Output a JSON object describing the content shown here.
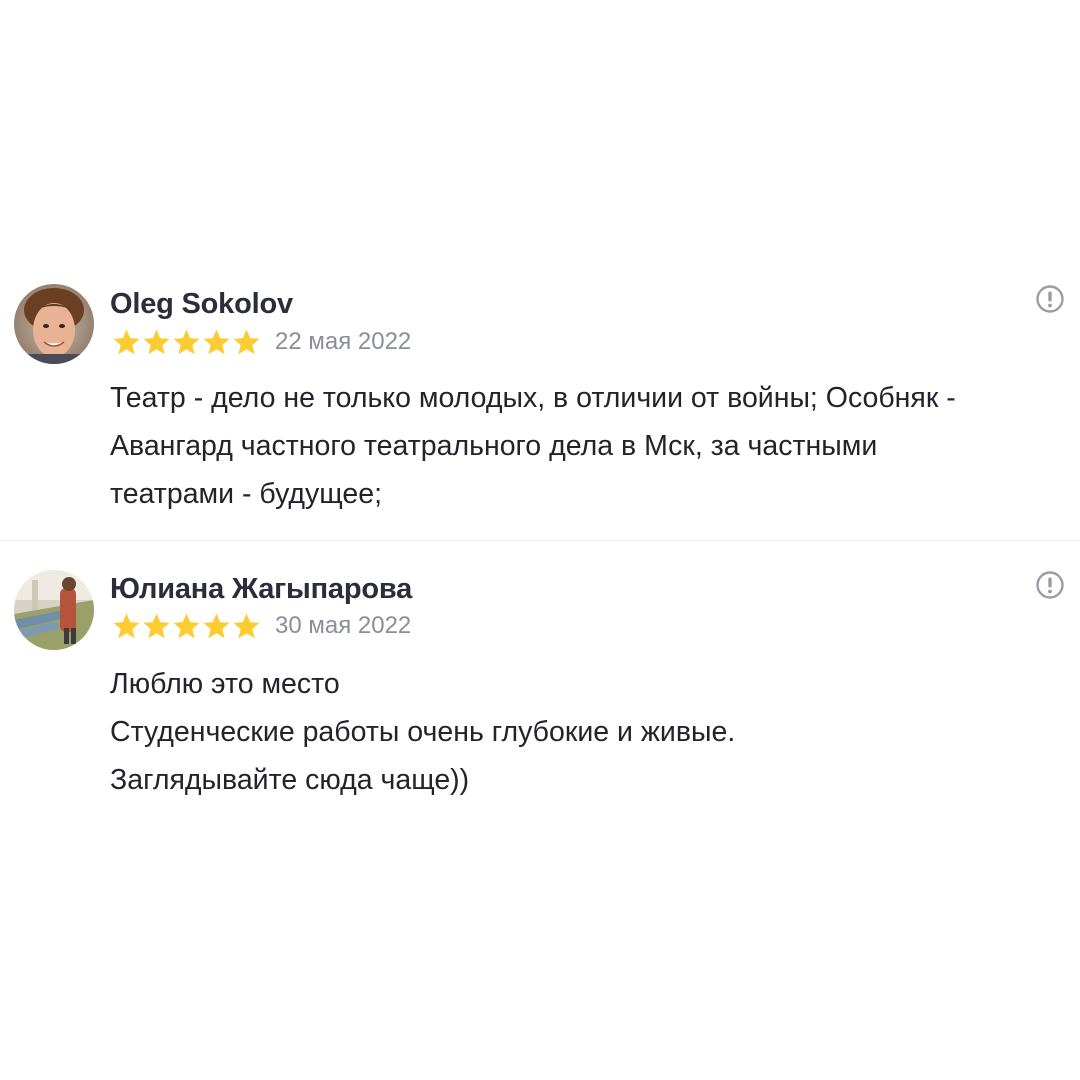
{
  "colors": {
    "star": "#fdcc33",
    "author": "#2b2d3a",
    "date": "#8a8d9a",
    "text": "#22232d",
    "icon": "#9a9ca6",
    "divider": "#ececef"
  },
  "reviews": [
    {
      "author": "Oleg Sokolov",
      "rating": 5,
      "date": "22 мая 2022",
      "text_lines": [
        "Театр - дело не только молодых, в отличии от войны; Особняк -",
        "Авангард частного театрального дела в Мск, за частными",
        "театрами - будущее;"
      ],
      "report_icon": "exclamation-circle-icon"
    },
    {
      "author": "Юлиана Жагыпарова",
      "rating": 5,
      "date": "30 мая 2022",
      "text_lines": [
        "Люблю это место",
        "Студенческие работы очень глубокие и живые.",
        "Заглядывайте сюда чаще))"
      ],
      "report_icon": "exclamation-circle-icon"
    }
  ]
}
